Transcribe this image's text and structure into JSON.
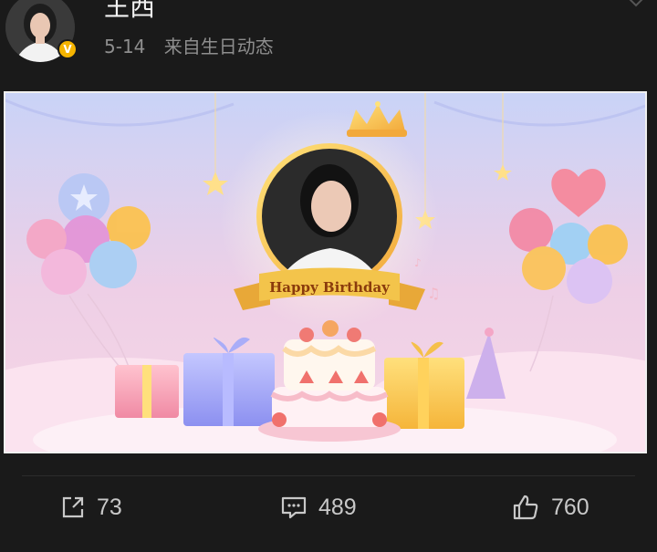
{
  "post": {
    "author": "王西",
    "date": "5-14",
    "source": "来自生日动态",
    "verified_badge": "V",
    "image": {
      "banner_text": "Happy Birthday"
    }
  },
  "actions": {
    "share_count": "73",
    "comment_count": "489",
    "like_count": "760"
  },
  "icons": {
    "share": "share-icon",
    "comment": "comment-icon",
    "like": "thumbs-up-icon",
    "more": "chevron-down-icon"
  },
  "colors": {
    "background": "#1a1a1a",
    "text_primary": "#f2f2f2",
    "text_secondary": "#8e8e8e",
    "verified": "#f5b400",
    "banner_gold": "#f3c44b"
  }
}
